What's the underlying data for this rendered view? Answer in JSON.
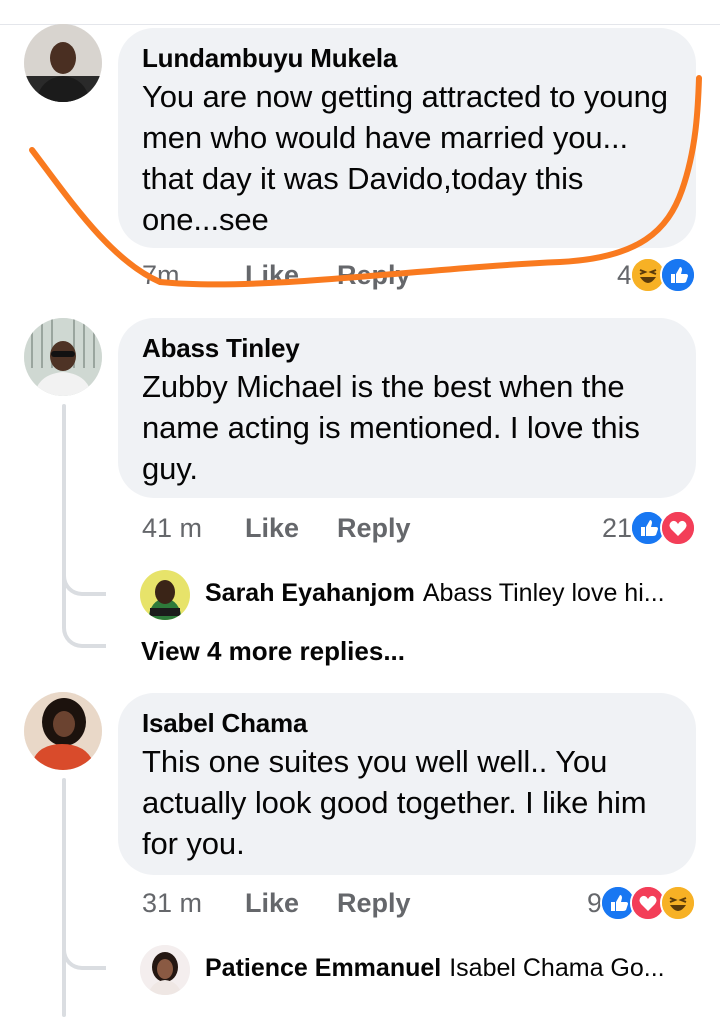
{
  "comments": [
    {
      "author": "Lundambuyu Mukela",
      "text": "You are now getting attracted to young men who would have married you... that day it was Davido,today this one...see",
      "time": "7m",
      "like": "Like",
      "reply": "Reply",
      "reaction_count": "4",
      "reactions": [
        "haha",
        "like"
      ]
    },
    {
      "author": "Abass Tinley",
      "text": "Zubby Michael is the best when the name acting is mentioned. I love this guy.",
      "time": "41 m",
      "like": "Like",
      "reply": "Reply",
      "reaction_count": "21",
      "reactions": [
        "like",
        "love"
      ],
      "reply_preview": {
        "author": "Sarah Eyahanjom",
        "text": "Abass Tinley love hi..."
      },
      "view_more": "View 4 more replies..."
    },
    {
      "author": "Isabel Chama",
      "text": "This one suites you well well.. You actually look good together. I like him for you.",
      "time": "31 m",
      "like": "Like",
      "reply": "Reply",
      "reaction_count": "9",
      "reactions": [
        "like",
        "love",
        "haha"
      ],
      "reply_preview": {
        "author": "Patience Emmanuel",
        "text": "Isabel Chama Go..."
      }
    }
  ],
  "colors": {
    "bubble": "#f0f2f5",
    "meta": "#65676b",
    "like_blue": "#1877f2",
    "love_red": "#f33e58",
    "haha_yellow": "#f7b125",
    "annotation_orange": "#f97a1f"
  }
}
